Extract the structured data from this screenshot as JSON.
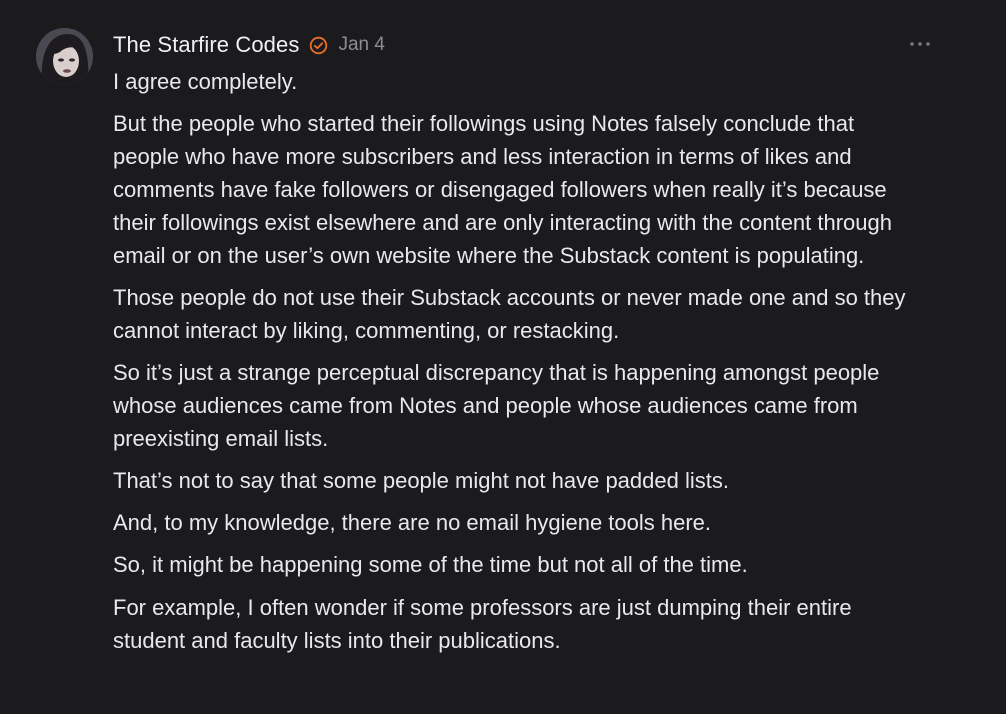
{
  "comment": {
    "author": "The Starfire Codes",
    "date": "Jan 4",
    "verified_icon": "verified-check-icon",
    "more_icon": "ellipsis-icon",
    "accent_color": "#e8702a",
    "paragraphs": [
      "I agree completely.",
      "But the people who started their followings using Notes falsely conclude that people who have more subscribers and less interaction in terms of likes and comments have fake followers or disengaged followers when really it’s because their followings exist elsewhere and are only interacting with the content through email or on the user’s own website where the Substack content is populating.",
      "Those people do not use their Substack accounts or never made one and so they cannot interact by liking, commenting, or restacking.",
      "So it’s just a strange perceptual discrepancy that is happening amongst people whose audiences came from Notes and people whose audiences came from preexisting email lists.",
      "That’s not to say that some people might not have padded lists.",
      "And, to my knowledge, there are no email hygiene tools here.",
      "So, it might be happening some of the time but not all of the time.",
      "For example, I often wonder if some professors are just dumping their entire student and faculty lists into their publications."
    ]
  }
}
